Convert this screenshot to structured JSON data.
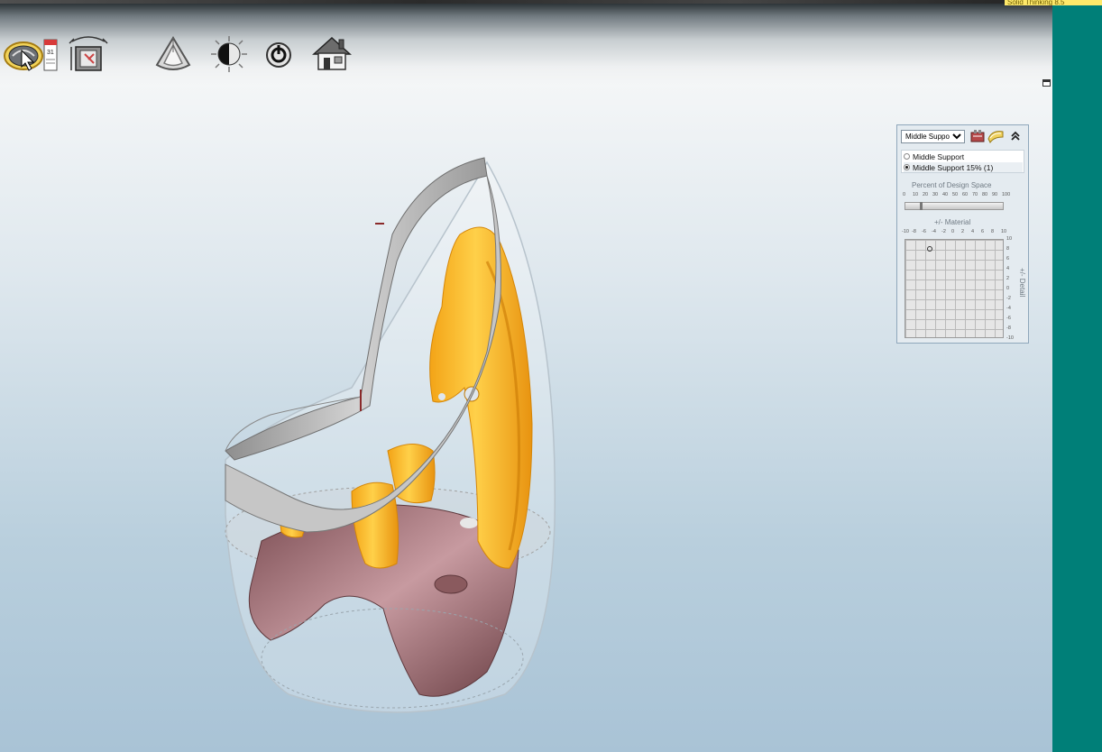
{
  "notification": {
    "text": "Solid Thinking 8.5"
  },
  "toolbar": {
    "icons": [
      "view-mode-icon",
      "history-icon",
      "measure-icon",
      "shape-icon",
      "render-icon",
      "reset-icon",
      "home-icon"
    ]
  },
  "panel": {
    "dropdown": {
      "selected": "Middle Suppor",
      "options": [
        "Middle Suppor"
      ]
    },
    "radio_options": [
      {
        "label": "Middle Support",
        "selected": false
      },
      {
        "label": "Middle Support 15% (1)",
        "selected": true
      }
    ],
    "percent_label": "Percent of Design Space",
    "percent_ticks": [
      "0",
      "10",
      "20",
      "30",
      "40",
      "50",
      "60",
      "70",
      "80",
      "90",
      "100"
    ],
    "percent_value": 15,
    "material_label": "+/- Material",
    "material_ticks": [
      "-10",
      "-8",
      "-6",
      "-4",
      "-2",
      "0",
      "2",
      "4",
      "6",
      "8",
      "10"
    ],
    "detail_label": "+/- Detail",
    "detail_ticks": [
      "10",
      "8",
      "6",
      "4",
      "2",
      "0",
      "-2",
      "-4",
      "-6",
      "-8",
      "-10"
    ],
    "material_value": -5,
    "detail_value": 8
  },
  "colors": {
    "accent_band": "#007f78",
    "optimized_part": "#f2a51c",
    "design_space": "#9c9c9c",
    "base_part": "#8a5a5e"
  }
}
